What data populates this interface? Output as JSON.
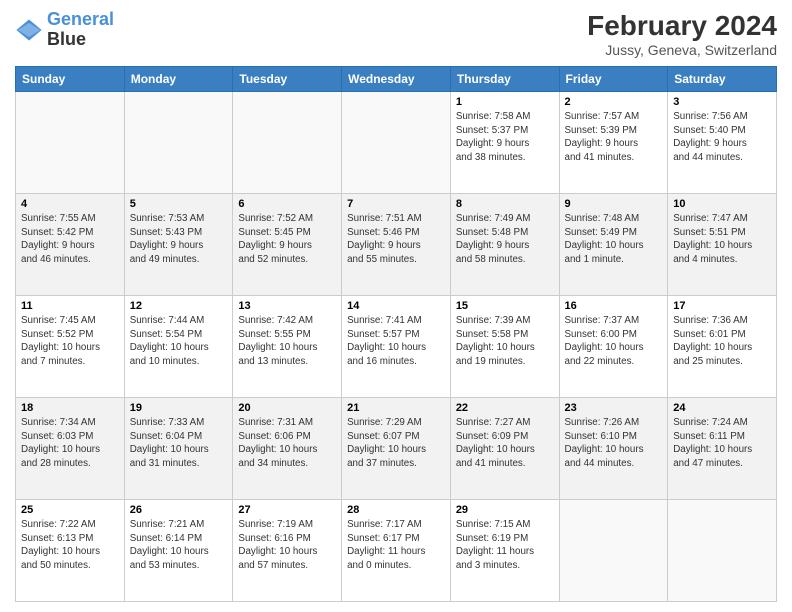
{
  "logo": {
    "line1": "General",
    "line2": "Blue"
  },
  "title": "February 2024",
  "location": "Jussy, Geneva, Switzerland",
  "days_of_week": [
    "Sunday",
    "Monday",
    "Tuesday",
    "Wednesday",
    "Thursday",
    "Friday",
    "Saturday"
  ],
  "weeks": [
    [
      {
        "day": "",
        "info": ""
      },
      {
        "day": "",
        "info": ""
      },
      {
        "day": "",
        "info": ""
      },
      {
        "day": "",
        "info": ""
      },
      {
        "day": "1",
        "info": "Sunrise: 7:58 AM\nSunset: 5:37 PM\nDaylight: 9 hours\nand 38 minutes."
      },
      {
        "day": "2",
        "info": "Sunrise: 7:57 AM\nSunset: 5:39 PM\nDaylight: 9 hours\nand 41 minutes."
      },
      {
        "day": "3",
        "info": "Sunrise: 7:56 AM\nSunset: 5:40 PM\nDaylight: 9 hours\nand 44 minutes."
      }
    ],
    [
      {
        "day": "4",
        "info": "Sunrise: 7:55 AM\nSunset: 5:42 PM\nDaylight: 9 hours\nand 46 minutes."
      },
      {
        "day": "5",
        "info": "Sunrise: 7:53 AM\nSunset: 5:43 PM\nDaylight: 9 hours\nand 49 minutes."
      },
      {
        "day": "6",
        "info": "Sunrise: 7:52 AM\nSunset: 5:45 PM\nDaylight: 9 hours\nand 52 minutes."
      },
      {
        "day": "7",
        "info": "Sunrise: 7:51 AM\nSunset: 5:46 PM\nDaylight: 9 hours\nand 55 minutes."
      },
      {
        "day": "8",
        "info": "Sunrise: 7:49 AM\nSunset: 5:48 PM\nDaylight: 9 hours\nand 58 minutes."
      },
      {
        "day": "9",
        "info": "Sunrise: 7:48 AM\nSunset: 5:49 PM\nDaylight: 10 hours\nand 1 minute."
      },
      {
        "day": "10",
        "info": "Sunrise: 7:47 AM\nSunset: 5:51 PM\nDaylight: 10 hours\nand 4 minutes."
      }
    ],
    [
      {
        "day": "11",
        "info": "Sunrise: 7:45 AM\nSunset: 5:52 PM\nDaylight: 10 hours\nand 7 minutes."
      },
      {
        "day": "12",
        "info": "Sunrise: 7:44 AM\nSunset: 5:54 PM\nDaylight: 10 hours\nand 10 minutes."
      },
      {
        "day": "13",
        "info": "Sunrise: 7:42 AM\nSunset: 5:55 PM\nDaylight: 10 hours\nand 13 minutes."
      },
      {
        "day": "14",
        "info": "Sunrise: 7:41 AM\nSunset: 5:57 PM\nDaylight: 10 hours\nand 16 minutes."
      },
      {
        "day": "15",
        "info": "Sunrise: 7:39 AM\nSunset: 5:58 PM\nDaylight: 10 hours\nand 19 minutes."
      },
      {
        "day": "16",
        "info": "Sunrise: 7:37 AM\nSunset: 6:00 PM\nDaylight: 10 hours\nand 22 minutes."
      },
      {
        "day": "17",
        "info": "Sunrise: 7:36 AM\nSunset: 6:01 PM\nDaylight: 10 hours\nand 25 minutes."
      }
    ],
    [
      {
        "day": "18",
        "info": "Sunrise: 7:34 AM\nSunset: 6:03 PM\nDaylight: 10 hours\nand 28 minutes."
      },
      {
        "day": "19",
        "info": "Sunrise: 7:33 AM\nSunset: 6:04 PM\nDaylight: 10 hours\nand 31 minutes."
      },
      {
        "day": "20",
        "info": "Sunrise: 7:31 AM\nSunset: 6:06 PM\nDaylight: 10 hours\nand 34 minutes."
      },
      {
        "day": "21",
        "info": "Sunrise: 7:29 AM\nSunset: 6:07 PM\nDaylight: 10 hours\nand 37 minutes."
      },
      {
        "day": "22",
        "info": "Sunrise: 7:27 AM\nSunset: 6:09 PM\nDaylight: 10 hours\nand 41 minutes."
      },
      {
        "day": "23",
        "info": "Sunrise: 7:26 AM\nSunset: 6:10 PM\nDaylight: 10 hours\nand 44 minutes."
      },
      {
        "day": "24",
        "info": "Sunrise: 7:24 AM\nSunset: 6:11 PM\nDaylight: 10 hours\nand 47 minutes."
      }
    ],
    [
      {
        "day": "25",
        "info": "Sunrise: 7:22 AM\nSunset: 6:13 PM\nDaylight: 10 hours\nand 50 minutes."
      },
      {
        "day": "26",
        "info": "Sunrise: 7:21 AM\nSunset: 6:14 PM\nDaylight: 10 hours\nand 53 minutes."
      },
      {
        "day": "27",
        "info": "Sunrise: 7:19 AM\nSunset: 6:16 PM\nDaylight: 10 hours\nand 57 minutes."
      },
      {
        "day": "28",
        "info": "Sunrise: 7:17 AM\nSunset: 6:17 PM\nDaylight: 11 hours\nand 0 minutes."
      },
      {
        "day": "29",
        "info": "Sunrise: 7:15 AM\nSunset: 6:19 PM\nDaylight: 11 hours\nand 3 minutes."
      },
      {
        "day": "",
        "info": ""
      },
      {
        "day": "",
        "info": ""
      }
    ]
  ],
  "shaded_rows": [
    1,
    3
  ]
}
